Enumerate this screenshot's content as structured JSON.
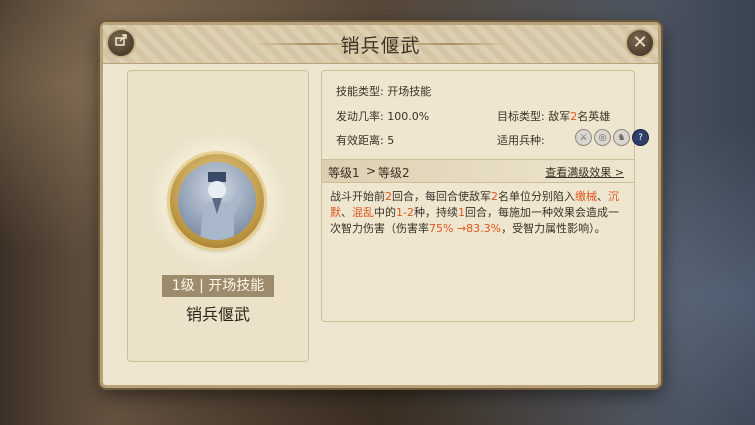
{
  "dialog": {
    "title": "销兵偃武",
    "share_icon": "share-icon",
    "close_icon": "close-icon"
  },
  "left_panel": {
    "level_label": "1级 | 开场技能",
    "skill_name": "销兵偃武"
  },
  "info": {
    "skill_type_label": "技能类型:",
    "skill_type_value": "开场技能",
    "chance_label": "发动几率:",
    "chance_value": "100.0%",
    "target_label": "目标类型:",
    "target_prefix": "敌军",
    "target_num": "2",
    "target_suffix": "名英雄",
    "range_label": "有效距离:",
    "range_value": "5",
    "troop_label": "适用兵种:",
    "troops": [
      "sword-icon",
      "shield-icon",
      "horse-icon",
      "question-icon"
    ]
  },
  "level_bar": {
    "from": "等级1",
    "arrow": ">",
    "to": "等级2",
    "view_full": "查看满级效果 >"
  },
  "desc": {
    "p1": "战斗开始前",
    "n1": "2",
    "p2": "回合，每回合使敌军",
    "n2": "2",
    "p3": "名单位分别陷入",
    "s1": "缴械",
    "p4": "、",
    "s2": "沉默",
    "p5": "、",
    "s3": "混乱",
    "p6": "中的",
    "n3": "1-2",
    "p7": "种，持续",
    "n4": "1",
    "p8": "回合，每施加一种效果会造成一次智力伤害（伤害率",
    "n5": "75% →83.3%",
    "p9": "，受智力属性影响）。"
  },
  "colors": {
    "highlight": "#e0541d",
    "text": "#3a3125",
    "panel": "#efe6d0"
  }
}
